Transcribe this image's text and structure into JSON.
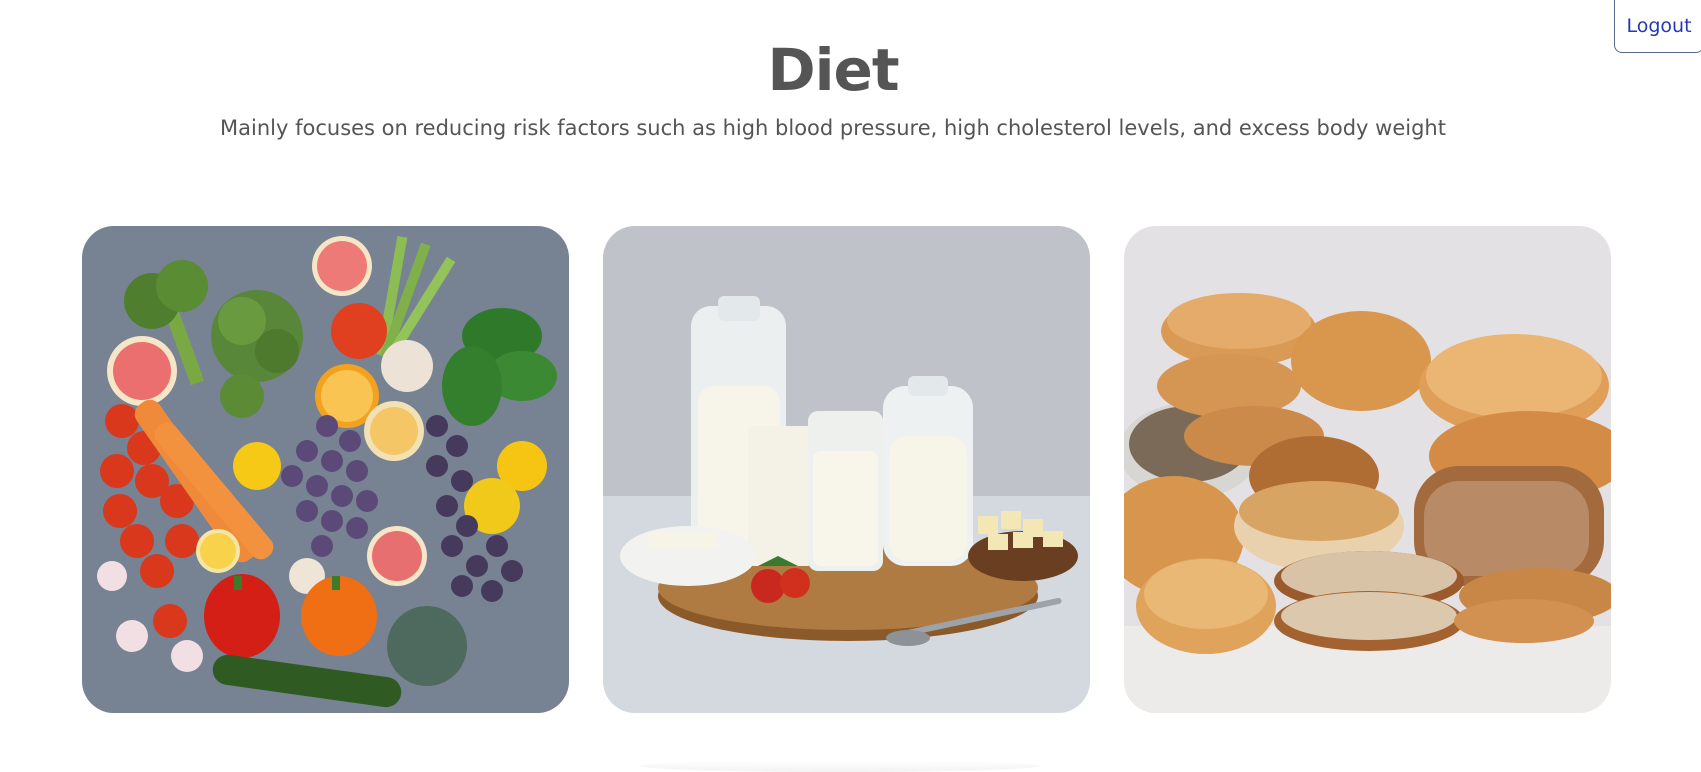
{
  "header": {
    "logout_label": "Logout"
  },
  "page": {
    "title": "Diet",
    "subtitle": "Mainly focuses on reducing risk factors such as high blood pressure, high cholesterol levels, and excess body weight"
  },
  "colors": {
    "text": "#555555",
    "logout_text": "#2538b8",
    "background": "#ffffff"
  }
}
